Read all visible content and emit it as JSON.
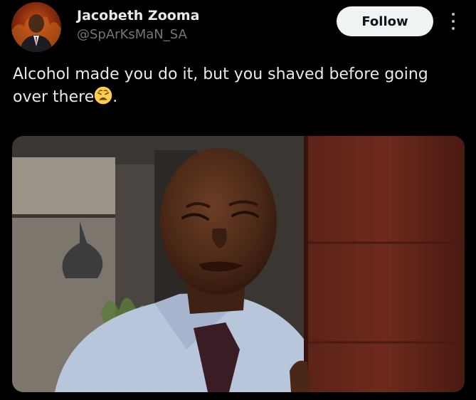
{
  "author": {
    "display_name": "Jacobeth Zooma",
    "handle": "@SpArKsMaN_SA"
  },
  "actions": {
    "follow_label": "Follow",
    "more_icon": "more-vertical-icon"
  },
  "tweet": {
    "text_before_emoji": "Alcohol made you do it, but you shaved before going over there",
    "emoji": "weary-face-emoji",
    "text_after_emoji": "."
  },
  "media": {
    "type": "image",
    "subject": "bald man in light-blue shirt and dark tie squinting beside a reddish-brown wooden door, kitchen background"
  },
  "colors": {
    "background": "#000000",
    "primary_text": "#e7e9ea",
    "secondary_text": "#71767b",
    "follow_button_bg": "#eff3f4",
    "follow_button_text": "#0f1419"
  }
}
